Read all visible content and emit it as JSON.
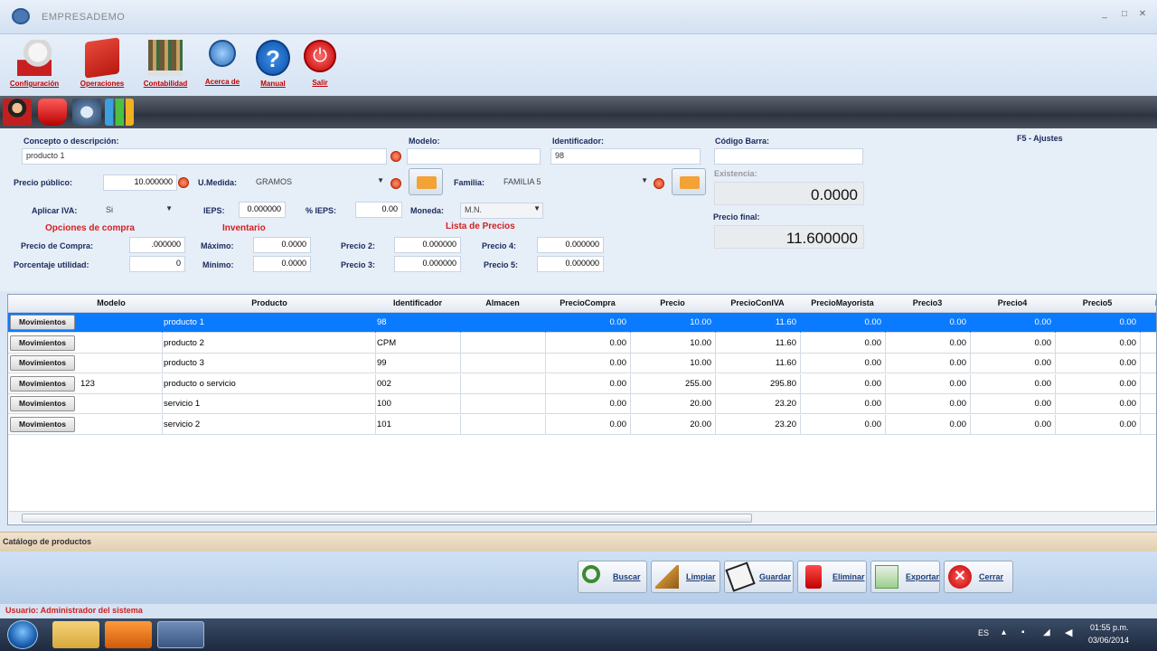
{
  "window": {
    "title": "EMPRESADEMO"
  },
  "menu": [
    {
      "label": "Configuración",
      "icon": "config-icon"
    },
    {
      "label": "Operaciones",
      "icon": "folder-icon"
    },
    {
      "label": "Contabilidad",
      "icon": "books-icon"
    },
    {
      "label": "Acerca de",
      "icon": "about-icon"
    },
    {
      "label": "Manual",
      "icon": "help-icon"
    },
    {
      "label": "Salir",
      "icon": "power-icon"
    }
  ],
  "form": {
    "concepto_label": "Concepto o descripción:",
    "concepto_value": "producto 1",
    "modelo_label": "Modelo:",
    "modelo_value": "",
    "identificador_label": "Identificador:",
    "identificador_value": "98",
    "codigo_barra_label": "Código Barra:",
    "codigo_barra_value": "",
    "ajustes_label": "F5 - Ajustes",
    "precio_publico_label": "Precio público:",
    "precio_publico_value": "10.000000",
    "umedida_label": "U.Medida:",
    "umedida_value": "GRAMOS",
    "familia_label": "Familia:",
    "familia_value": "FAMILIA 5",
    "existencia_label": "Existencia:",
    "existencia_value": "0.0000",
    "aplicar_iva_label": "Aplicar IVA:",
    "aplicar_iva_value": "Si",
    "ieps_label": "IEPS:",
    "ieps_value": "0.000000",
    "pct_ieps_label": "% IEPS:",
    "pct_ieps_value": "0.00",
    "moneda_label": "Moneda:",
    "moneda_value": "M.N.",
    "precio_final_label": "Precio final:",
    "precio_final_value": "11.600000",
    "opciones_compra_title": "Opciones de compra",
    "inventario_title": "Inventario",
    "lista_precios_title": "Lista de Precios",
    "precio_compra_label": "Precio de Compra:",
    "precio_compra_value": ".000000",
    "porcentaje_utilidad_label": "Porcentaje utilidad:",
    "porcentaje_utilidad_value": "0",
    "maximo_label": "Máximo:",
    "maximo_value": "0.0000",
    "minimo_label": "Mínimo:",
    "minimo_value": "0.0000",
    "precio2_label": "Precio 2:",
    "precio2_value": "0.000000",
    "precio3_label": "Precio 3:",
    "precio3_value": "0.000000",
    "precio4_label": "Precio 4:",
    "precio4_value": "0.000000",
    "precio5_label": "Precio 5:",
    "precio5_value": "0.000000"
  },
  "grid": {
    "columns": [
      "Modelo",
      "Producto",
      "Identificador",
      "Almacen",
      "PrecioCompra",
      "Precio",
      "PrecioConIVA",
      "PrecioMayorista",
      "Precio3",
      "Precio4",
      "Precio5",
      "E"
    ],
    "button_label": "Movimientos",
    "rows": [
      {
        "modelo": "",
        "producto": "producto 1",
        "identificador": "98",
        "almacen": "",
        "precio_compra": "0.00",
        "precio": "10.00",
        "precio_con_iva": "11.60",
        "precio_mayorista": "0.00",
        "precio3": "0.00",
        "precio4": "0.00",
        "precio5": "0.00",
        "selected": true
      },
      {
        "modelo": "",
        "producto": "producto 2",
        "identificador": "CPM",
        "almacen": "",
        "precio_compra": "0.00",
        "precio": "10.00",
        "precio_con_iva": "11.60",
        "precio_mayorista": "0.00",
        "precio3": "0.00",
        "precio4": "0.00",
        "precio5": "0.00",
        "selected": false
      },
      {
        "modelo": "",
        "producto": "producto 3",
        "identificador": "99",
        "almacen": "",
        "precio_compra": "0.00",
        "precio": "10.00",
        "precio_con_iva": "11.60",
        "precio_mayorista": "0.00",
        "precio3": "0.00",
        "precio4": "0.00",
        "precio5": "0.00",
        "selected": false
      },
      {
        "modelo": "123",
        "producto": "producto o servicio",
        "identificador": "002",
        "almacen": "",
        "precio_compra": "0.00",
        "precio": "255.00",
        "precio_con_iva": "295.80",
        "precio_mayorista": "0.00",
        "precio3": "0.00",
        "precio4": "0.00",
        "precio5": "0.00",
        "selected": false
      },
      {
        "modelo": "",
        "producto": "servicio 1",
        "identificador": "100",
        "almacen": "",
        "precio_compra": "0.00",
        "precio": "20.00",
        "precio_con_iva": "23.20",
        "precio_mayorista": "0.00",
        "precio3": "0.00",
        "precio4": "0.00",
        "precio5": "0.00",
        "selected": false
      },
      {
        "modelo": "",
        "producto": "servicio 2",
        "identificador": "101",
        "almacen": "",
        "precio_compra": "0.00",
        "precio": "20.00",
        "precio_con_iva": "23.20",
        "precio_mayorista": "0.00",
        "precio3": "0.00",
        "precio4": "0.00",
        "precio5": "0.00",
        "selected": false
      }
    ]
  },
  "caption": "Catálogo de productos",
  "actions": [
    {
      "label": "Buscar",
      "icon": "search-icon"
    },
    {
      "label": "Limpiar",
      "icon": "broom-icon"
    },
    {
      "label": "Guardar",
      "icon": "save-icon"
    },
    {
      "label": "Eliminar",
      "icon": "delete-icon"
    },
    {
      "label": "Exportar",
      "icon": "export-icon"
    },
    {
      "label": "Cerrar",
      "icon": "close-icon"
    }
  ],
  "status": "Usuario: Administrador del sistema",
  "taskbar": {
    "lang": "ES",
    "time": "01:55 p.m.",
    "date": "03/06/2014"
  },
  "colors": {
    "accent_red": "#d32020",
    "selection_blue": "#0a7bff",
    "label_blue": "#1a2a5a"
  }
}
